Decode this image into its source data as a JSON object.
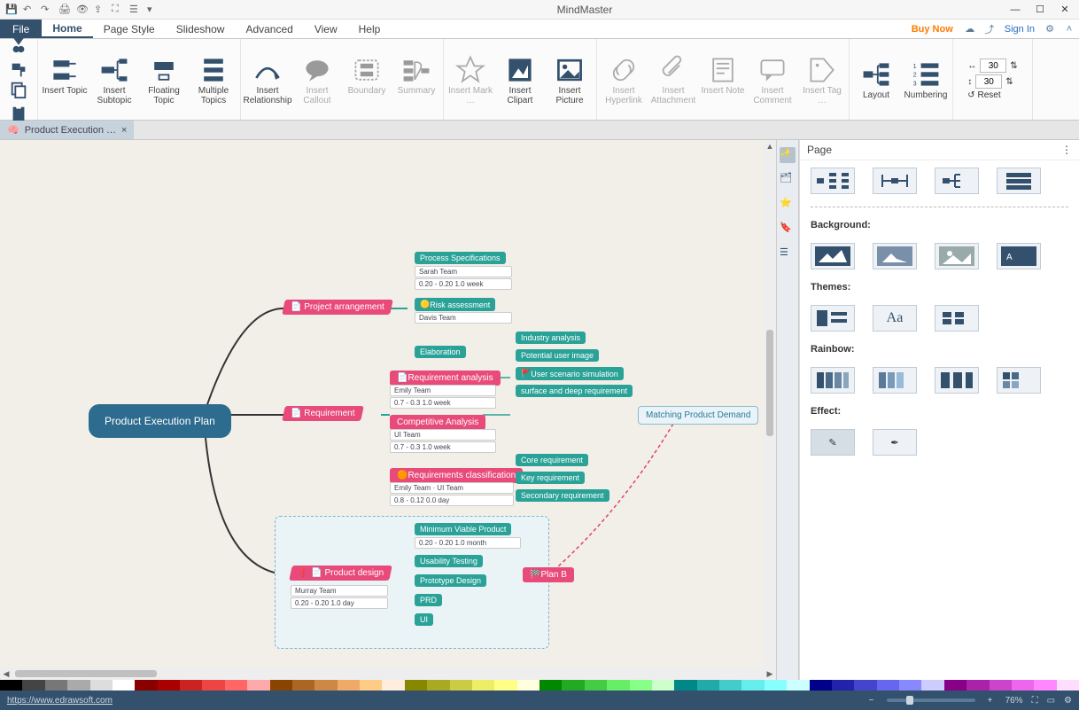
{
  "app": {
    "title": "MindMaster"
  },
  "qat_icons": [
    "save-icon",
    "undo-icon",
    "redo-icon",
    "print-icon",
    "preview-icon",
    "export-icon",
    "fit-icon",
    "options-icon",
    "dropdown-icon"
  ],
  "menu_tabs": [
    "Home",
    "Page Style",
    "Slideshow",
    "Advanced",
    "View",
    "Help"
  ],
  "active_tab": "Home",
  "top_right": {
    "buy_now": "Buy Now",
    "sign_in": "Sign In"
  },
  "ribbon": {
    "clipboard": [
      "cut-icon",
      "copy-icon",
      "paste-icon",
      "format-painter-icon"
    ],
    "insert_topics": [
      {
        "id": "insert-topic",
        "label": "Insert Topic"
      },
      {
        "id": "insert-subtopic",
        "label": "Insert Subtopic"
      },
      {
        "id": "floating-topic",
        "label": "Floating Topic"
      },
      {
        "id": "multiple-topics",
        "label": "Multiple Topics"
      }
    ],
    "insert_rels": [
      {
        "id": "insert-relationship",
        "label": "Insert Relationship",
        "enabled": true
      },
      {
        "id": "insert-callout",
        "label": "Insert Callout",
        "enabled": false
      },
      {
        "id": "boundary",
        "label": "Boundary",
        "enabled": false
      },
      {
        "id": "summary",
        "label": "Summary",
        "enabled": false
      }
    ],
    "insert_media": [
      {
        "id": "insert-mark",
        "label": "Insert Mark …",
        "enabled": false
      },
      {
        "id": "insert-clipart",
        "label": "Insert Clipart",
        "enabled": true
      },
      {
        "id": "insert-picture",
        "label": "Insert Picture",
        "enabled": true
      }
    ],
    "insert_attach": [
      {
        "id": "insert-hyperlink",
        "label": "Insert Hyperlink",
        "enabled": false
      },
      {
        "id": "insert-attachment",
        "label": "Insert Attachment",
        "enabled": false
      },
      {
        "id": "insert-note",
        "label": "Insert Note",
        "enabled": false
      },
      {
        "id": "insert-comment",
        "label": "Insert Comment",
        "enabled": false
      },
      {
        "id": "insert-tag",
        "label": "Insert Tag …",
        "enabled": false
      }
    ],
    "layout": [
      {
        "id": "layout",
        "label": "Layout"
      },
      {
        "id": "numbering",
        "label": "Numbering"
      }
    ],
    "spacing": {
      "h": "30",
      "v": "30",
      "reset": "Reset"
    }
  },
  "document_tab": {
    "title": "Product Execution …"
  },
  "mindmap": {
    "central": "Product Execution Plan",
    "branches": [
      {
        "id": "project-arrangement",
        "label": "Project arrangement",
        "color": "pink",
        "children": [
          {
            "id": "process-specifications",
            "label": "Process Specifications",
            "info": [
              "Sarah Team",
              "0.20 - 0.20   1.0 week"
            ]
          },
          {
            "id": "risk-assessment",
            "label": "Risk assessment",
            "info": [
              "Davis Team"
            ]
          },
          {
            "id": "elaboration",
            "label": "Elaboration"
          }
        ]
      },
      {
        "id": "requirement",
        "label": "Requirement",
        "color": "pink",
        "children": [
          {
            "id": "requirement-analysis",
            "label": "Requirement analysis",
            "info": [
              "Emily Team",
              "0.7 - 0.3   1.0 week"
            ],
            "sub": [
              "Industry analysis",
              "Potential user image",
              "User scenario simulation",
              "surface and deep requirement"
            ]
          },
          {
            "id": "competitive-analysis",
            "label": "Competitive Analysis",
            "info": [
              "UI Team",
              "0.7 - 0.3   1.0 week"
            ]
          },
          {
            "id": "requirements-classification",
            "label": "Requirements classification",
            "info": [
              "Emily Team · UI Team",
              "0.8 - 0.12   0.0 day"
            ],
            "sub": [
              "Core requirement",
              "Key requirement",
              "Secondary requirement"
            ]
          }
        ]
      },
      {
        "id": "product-design",
        "label": "Product design",
        "color": "pink",
        "marked": true,
        "info": [
          "Murray Team",
          "0.20 - 0.20   1.0 day"
        ],
        "children": [
          {
            "id": "minimum-viable-product",
            "label": "Minimum Viable Product",
            "info": [
              "0.20 - 0.20   1.0 month"
            ]
          },
          {
            "id": "usability-testing",
            "label": "Usability Testing"
          },
          {
            "id": "prototype-design",
            "label": "Prototype Design"
          },
          {
            "id": "prd",
            "label": "PRD"
          },
          {
            "id": "ui",
            "label": "UI"
          }
        ],
        "right_link": {
          "id": "plan-b",
          "label": "Plan B"
        }
      }
    ],
    "floating": {
      "id": "matching-product-demand",
      "label": "Matching Product Demand"
    }
  },
  "panel": {
    "title": "Page",
    "sections": {
      "layouts_label": "",
      "background_label": "Background:",
      "themes_label": "Themes:",
      "rainbow_label": "Rainbow:",
      "effect_label": "Effect:"
    }
  },
  "side_rail": [
    "wand-icon",
    "map-icon",
    "clipart-icon",
    "bookmark-icon",
    "outline-icon"
  ],
  "status": {
    "link": "https://www.edrawsoft.com",
    "zoom_pct": "76%"
  },
  "colorbar_hues": [
    "#000",
    "#444",
    "#777",
    "#aaa",
    "#ddd",
    "#fff",
    "#800",
    "#a00",
    "#c22",
    "#e44",
    "#f66",
    "#faa",
    "#840",
    "#a62",
    "#c84",
    "#ea6",
    "#fc8",
    "#fed",
    "#880",
    "#aa2",
    "#cc4",
    "#ee6",
    "#ff8",
    "#ffd",
    "#080",
    "#2a2",
    "#4c4",
    "#6e6",
    "#8f8",
    "#cfc",
    "#088",
    "#2aa",
    "#4cc",
    "#6ee",
    "#8ff",
    "#cff",
    "#008",
    "#22a",
    "#44c",
    "#66e",
    "#88f",
    "#ccf",
    "#808",
    "#a2a",
    "#c4c",
    "#e6e",
    "#f8f",
    "#fdf"
  ]
}
